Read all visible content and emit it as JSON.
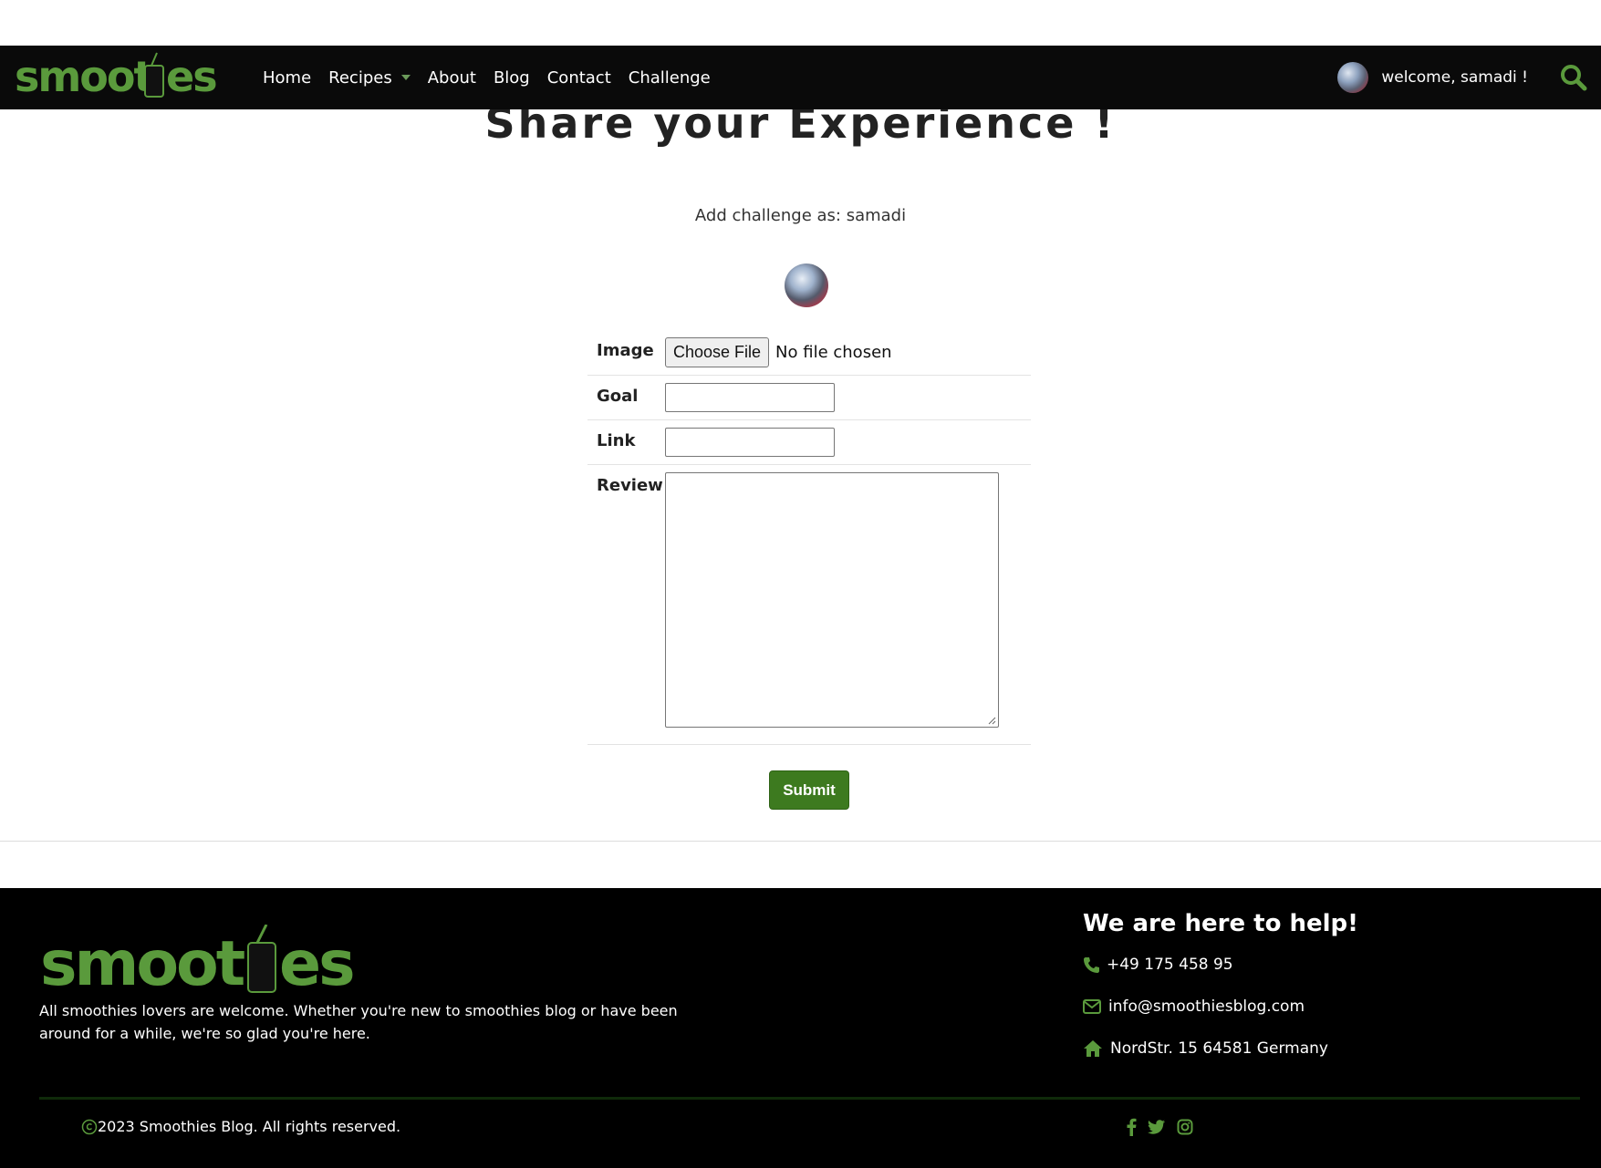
{
  "brand": {
    "logo_text": "smoothies",
    "accent": "#5a9a3c",
    "submit_color": "#3d7a1f"
  },
  "nav": {
    "items": [
      {
        "label": "Home"
      },
      {
        "label": "Recipes"
      },
      {
        "label": "About"
      },
      {
        "label": "Blog"
      },
      {
        "label": "Contact"
      },
      {
        "label": "Challenge"
      }
    ],
    "welcome": "welcome, samadi !",
    "search_icon": "search-icon"
  },
  "main": {
    "title": "Share your Experience !",
    "subtitle": "Add challenge as: samadi",
    "form": {
      "image_label": "Image",
      "choose_file": "Choose File",
      "no_file": "No file chosen",
      "goal_label": "Goal",
      "goal_value": "",
      "link_label": "Link",
      "link_value": "",
      "review_label": "Review",
      "review_value": "",
      "submit": "Submit"
    }
  },
  "footer": {
    "about": "All smoothies lovers are welcome. Whether you're new to smoothies blog or have been around for a while, we're so glad you're here.",
    "help_title": "We are here to help!",
    "phone": "+49 175 458 95",
    "email": "info@smoothiesblog.com",
    "address": "NordStr. 15 64581 Germany",
    "copyright": "2023 Smoothies Blog. All rights reserved.",
    "social": [
      "facebook-icon",
      "twitter-icon",
      "instagram-icon"
    ]
  }
}
